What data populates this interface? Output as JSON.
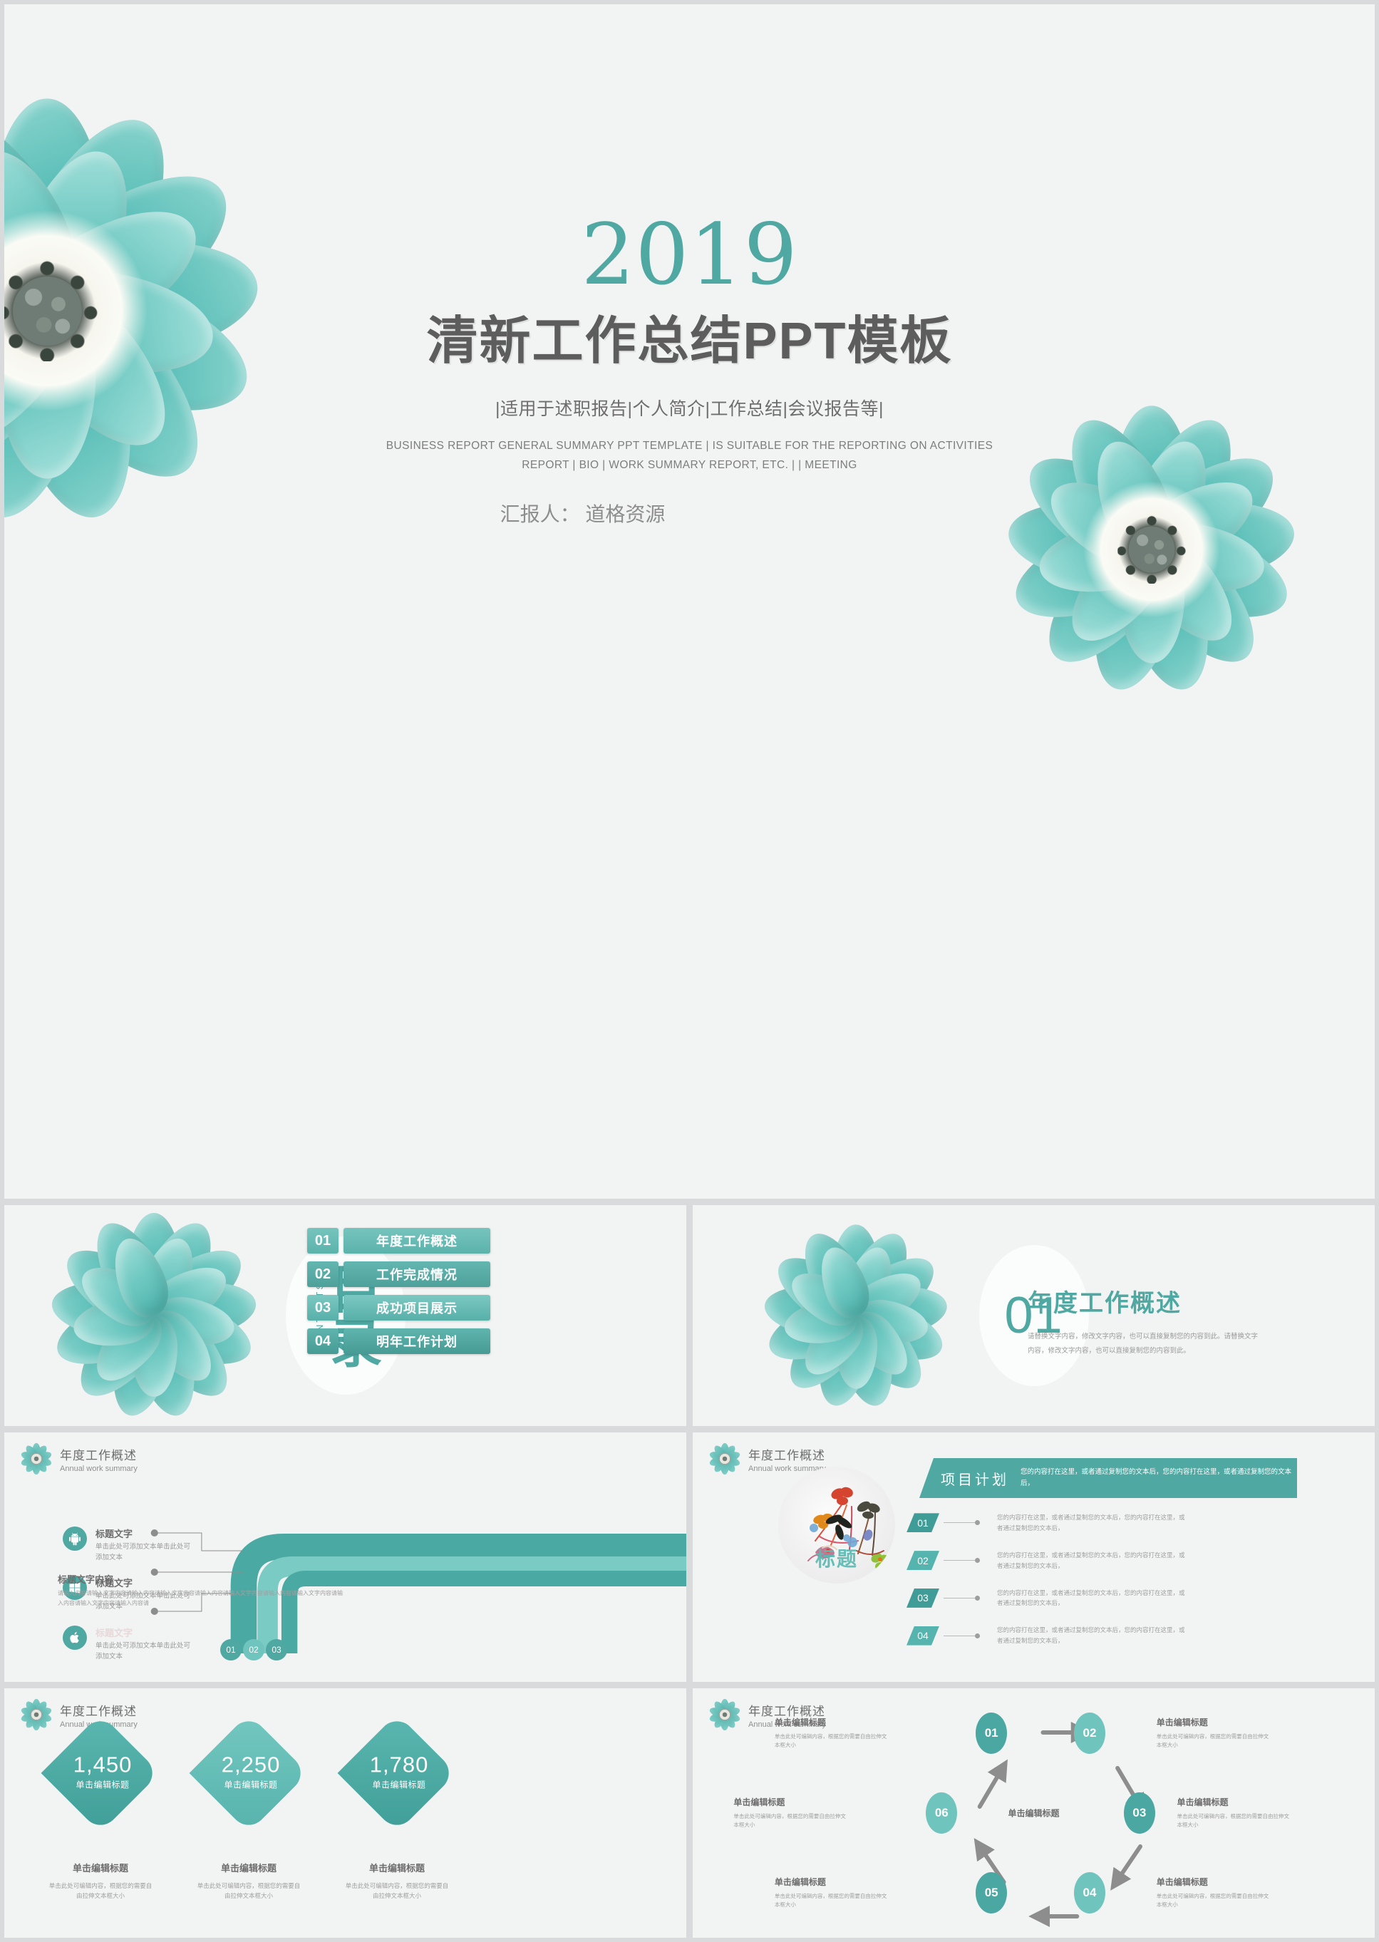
{
  "title_slide": {
    "year": "2019",
    "main_title": "清新工作总结PPT模板",
    "subtitle_cn": "|适用于述职报告|个人简介|工作总结|会议报告等|",
    "subtitle_en_line1": "BUSINESS REPORT GENERAL SUMMARY PPT TEMPLATE  | IS SUITABLE FOR THE REPORTING ON ACTIVITIES",
    "subtitle_en_line2": "REPORT | BIO | WORK SUMMARY REPORT, ETC. | | MEETING",
    "reporter": "汇报人： 道格资源"
  },
  "contents_slide": {
    "heading_cn": "目录",
    "heading_en": "CONTENTS",
    "items": [
      {
        "num": "01",
        "label": "年度工作概述"
      },
      {
        "num": "02",
        "label": "工作完成情况"
      },
      {
        "num": "03",
        "label": "成功项目展示"
      },
      {
        "num": "04",
        "label": "明年工作计划"
      }
    ]
  },
  "section_slide": {
    "number": "01",
    "title": "年度工作概述",
    "body": "请替换文字内容，修改文字内容，也可以直接复制您的内容到此。请替换文字内容，修改文字内容，也可以直接复制您的内容到此。"
  },
  "page_header": {
    "title_cn": "年度工作概述",
    "title_en": "Annual work summary"
  },
  "pipe_slide": {
    "items": [
      {
        "icon": "android-icon",
        "title": "标题文字",
        "body": "单击此处可添加文本单击此处可添加文本"
      },
      {
        "icon": "windows-icon",
        "title": "标题文字",
        "body": "单击此处可添加文本单击此处可添加文本"
      },
      {
        "icon": "apple-icon",
        "title": "标题文字",
        "body": "单击此处可添加文本单击此处可添加文本"
      }
    ],
    "pipe_numbers": [
      "01",
      "02",
      "03"
    ],
    "footer_title": "标题文字内容",
    "footer_body": "请输入内容请输入文字内容请输入内容请输入文字内容请输入内容请输入文字内容请输入内容请输入文字内容请输入内容请输入文字内容请输入内容请"
  },
  "plan_slide": {
    "image_label": "标题",
    "head_title": "项目计划",
    "head_body": "您的内容打在这里，或者通过复制您的文本后，您的内容打在这里，或者通过复制您的文本后，",
    "rows": [
      {
        "num": "01",
        "body": "您的内容打在这里，或者通过复制您的文本后，您的内容打在这里，或者通过复制您的文本后，"
      },
      {
        "num": "02",
        "body": "您的内容打在这里，或者通过复制您的文本后，您的内容打在这里，或者通过复制您的文本后，"
      },
      {
        "num": "03",
        "body": "您的内容打在这里，或者通过复制您的文本后，您的内容打在这里，或者通过复制您的文本后，"
      },
      {
        "num": "04",
        "body": "您的内容打在这里，或者通过复制您的文本后，您的内容打在这里，或者通过复制您的文本后，"
      }
    ]
  },
  "diamond_slide": {
    "items": [
      {
        "value": "1,450",
        "inner_label": "单击编辑标题",
        "caption_title": "单击编辑标题",
        "caption_body": "单击此处可编辑内容，根据您的需要自由拉伸文本框大小"
      },
      {
        "value": "2,250",
        "inner_label": "单击编辑标题",
        "caption_title": "单击编辑标题",
        "caption_body": "单击此处可编辑内容，根据您的需要自由拉伸文本框大小"
      },
      {
        "value": "1,780",
        "inner_label": "单击编辑标题",
        "caption_title": "单击编辑标题",
        "caption_body": "单击此处可编辑内容，根据您的需要自由拉伸文本框大小"
      }
    ]
  },
  "cycle_slide": {
    "center_label": "单击编辑标题",
    "nodes": [
      {
        "num": "01",
        "title": "单击编辑标题",
        "body": "单击此处可编辑内容，根据您的需要自由拉伸文本框大小"
      },
      {
        "num": "02",
        "title": "单击编辑标题",
        "body": "单击此处可编辑内容，根据您的需要自由拉伸文本框大小"
      },
      {
        "num": "03",
        "title": "单击编辑标题",
        "body": "单击此处可编辑内容，根据您的需要自由拉伸文本框大小"
      },
      {
        "num": "04",
        "title": "单击编辑标题",
        "body": "单击此处可编辑内容，根据您的需要自由拉伸文本框大小"
      },
      {
        "num": "05",
        "title": "单击编辑标题",
        "body": "单击此处可编辑内容，根据您的需要自由拉伸文本框大小"
      },
      {
        "num": "06",
        "title": "单击编辑标题",
        "body": "单击此处可编辑内容，根据您的需要自由拉伸文本框大小"
      }
    ]
  },
  "colors": {
    "accent_teal": "#4fa8a2",
    "accent_teal_light": "#6fc4bd",
    "accent_teal_dark": "#3f9c96",
    "slide_bg": "#f2f3f3",
    "gutter": "#d8dadc",
    "text_gray": "#6d6d6d",
    "text_muted": "#a0a0a0"
  }
}
